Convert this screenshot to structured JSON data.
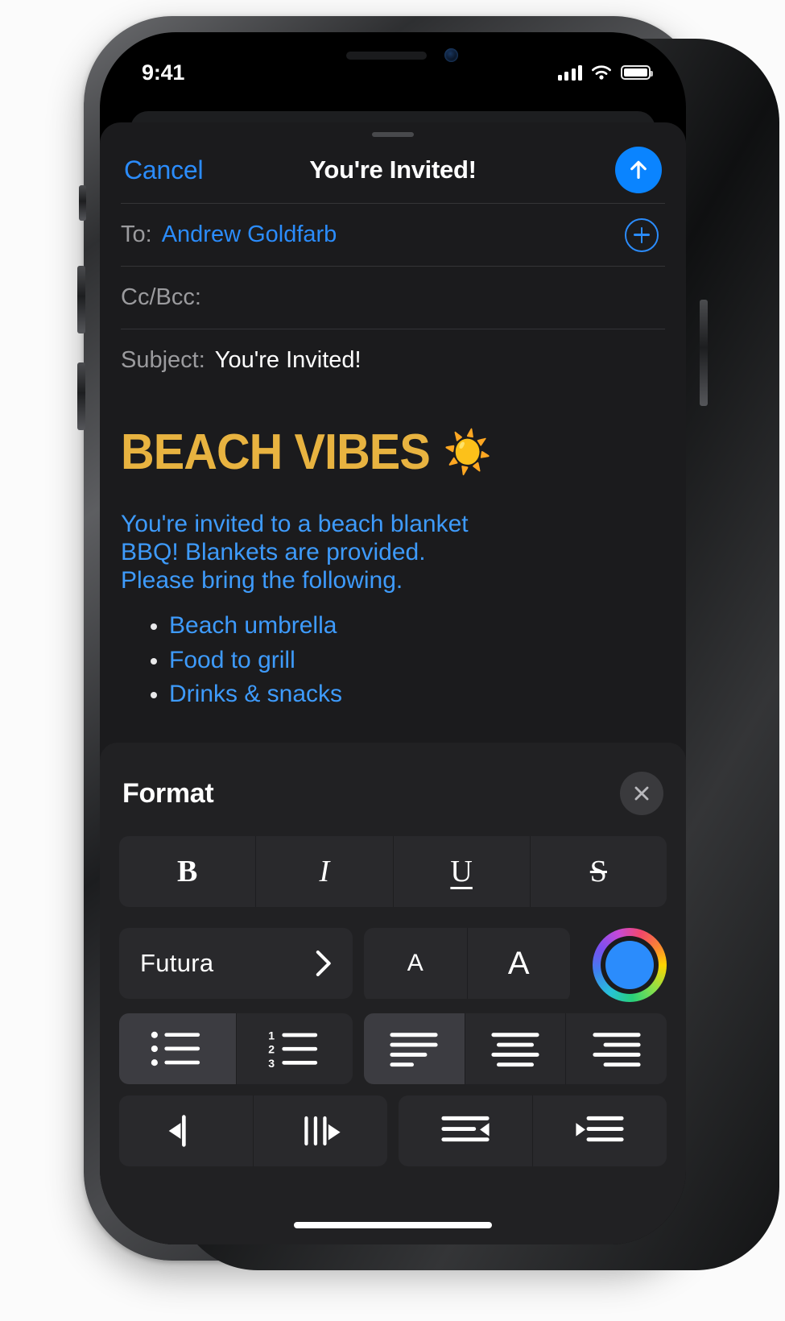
{
  "status_bar": {
    "time": "9:41",
    "cellular_icon": "cellular-bars-icon",
    "wifi_icon": "wifi-icon",
    "battery_icon": "battery-icon"
  },
  "navbar": {
    "cancel_label": "Cancel",
    "title": "You're Invited!",
    "send_icon": "send-arrow-up-icon"
  },
  "fields": {
    "to_label": "To:",
    "to_value": "Andrew Goldfarb",
    "add_contact_icon": "add-contact-plus-icon",
    "cc_bcc_label": "Cc/Bcc:",
    "cc_bcc_value": "",
    "subject_label": "Subject:",
    "subject_value": "You're Invited!"
  },
  "body": {
    "headline": "BEACH VIBES",
    "headline_emoji": "☀️",
    "headline_color": "#e8b340",
    "paragraph": "You're invited to a beach blanket BBQ! Blankets are provided. Please bring the following.",
    "text_color": "#3e9bfc",
    "list": [
      "Beach umbrella",
      "Food to grill",
      "Drinks & snacks"
    ]
  },
  "format_panel": {
    "title": "Format",
    "close_icon": "close-x-icon",
    "style_row": [
      {
        "name": "bold-button",
        "label": "B",
        "icon": "bold-icon",
        "active": false
      },
      {
        "name": "italic-button",
        "label": "I",
        "icon": "italic-icon",
        "active": false
      },
      {
        "name": "underline-button",
        "label": "U",
        "icon": "underline-icon",
        "active": false
      },
      {
        "name": "strikethrough-button",
        "label": "S",
        "icon": "strikethrough-icon",
        "active": false
      }
    ],
    "font_name": "Futura",
    "font_chevron_icon": "chevron-right-icon",
    "size_decrease_label": "A",
    "size_increase_label": "A",
    "color_wheel_icon": "color-wheel-icon",
    "selected_color": "#2b8cfc",
    "list_row": [
      {
        "name": "bulleted-list-button",
        "icon": "bulleted-list-icon",
        "active": true
      },
      {
        "name": "numbered-list-button",
        "icon": "numbered-list-icon",
        "active": false
      }
    ],
    "numbered_markers": [
      "1",
      "2",
      "3"
    ],
    "align_row": [
      {
        "name": "align-left-button",
        "icon": "align-left-icon",
        "active": true
      },
      {
        "name": "align-center-button",
        "icon": "align-center-icon",
        "active": false
      },
      {
        "name": "align-right-button",
        "icon": "align-right-icon",
        "active": false
      }
    ],
    "indent_row": [
      {
        "name": "outdent-button",
        "icon": "decrease-indent-bar-icon",
        "active": false
      },
      {
        "name": "writing-direction-button",
        "icon": "writing-direction-icon",
        "active": false
      },
      {
        "name": "decrease-indent-button",
        "icon": "decrease-indent-icon",
        "active": false
      },
      {
        "name": "increase-indent-button",
        "icon": "increase-indent-icon",
        "active": false
      }
    ]
  },
  "home_indicator": "home-indicator"
}
